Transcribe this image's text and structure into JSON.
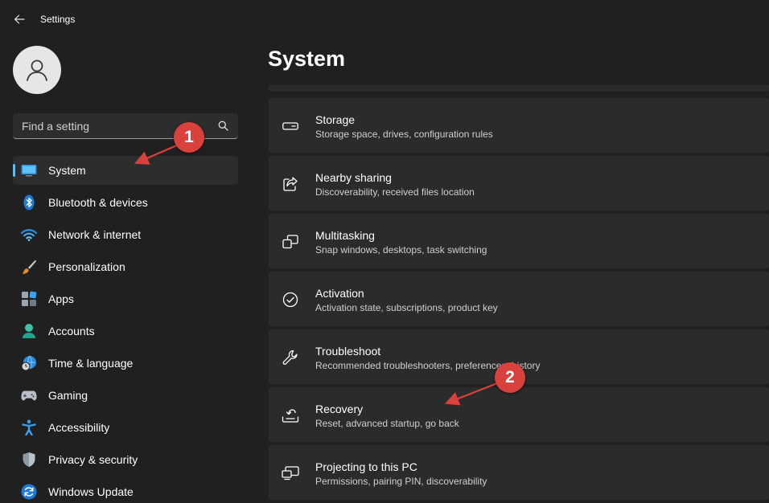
{
  "window": {
    "title": "Settings"
  },
  "search": {
    "placeholder": "Find a setting"
  },
  "sidebar": {
    "items": [
      {
        "label": "System",
        "icon": "monitor-icon",
        "selected": true
      },
      {
        "label": "Bluetooth & devices",
        "icon": "bluetooth-icon"
      },
      {
        "label": "Network & internet",
        "icon": "wifi-icon"
      },
      {
        "label": "Personalization",
        "icon": "paintbrush-icon"
      },
      {
        "label": "Apps",
        "icon": "apps-icon"
      },
      {
        "label": "Accounts",
        "icon": "person-icon"
      },
      {
        "label": "Time & language",
        "icon": "clock-globe-icon"
      },
      {
        "label": "Gaming",
        "icon": "gamepad-icon"
      },
      {
        "label": "Accessibility",
        "icon": "accessibility-icon"
      },
      {
        "label": "Privacy & security",
        "icon": "shield-icon"
      },
      {
        "label": "Windows Update",
        "icon": "update-icon"
      }
    ]
  },
  "main": {
    "title": "System",
    "cards": [
      {
        "title": "Storage",
        "subtitle": "Storage space, drives, configuration rules",
        "icon": "storage-icon"
      },
      {
        "title": "Nearby sharing",
        "subtitle": "Discoverability, received files location",
        "icon": "share-icon"
      },
      {
        "title": "Multitasking",
        "subtitle": "Snap windows, desktops, task switching",
        "icon": "multitasking-icon"
      },
      {
        "title": "Activation",
        "subtitle": "Activation state, subscriptions, product key",
        "icon": "check-circle-icon"
      },
      {
        "title": "Troubleshoot",
        "subtitle": "Recommended troubleshooters, preferences, history",
        "icon": "wrench-icon"
      },
      {
        "title": "Recovery",
        "subtitle": "Reset, advanced startup, go back",
        "icon": "recovery-icon"
      },
      {
        "title": "Projecting to this PC",
        "subtitle": "Permissions, pairing PIN, discoverability",
        "icon": "projecting-icon"
      }
    ]
  },
  "annotations": [
    {
      "number": "1"
    },
    {
      "number": "2"
    }
  ],
  "colors": {
    "accent": "#4cc2ff",
    "annotation": "#d9423c",
    "background": "#202020",
    "card": "#2b2b2b"
  }
}
